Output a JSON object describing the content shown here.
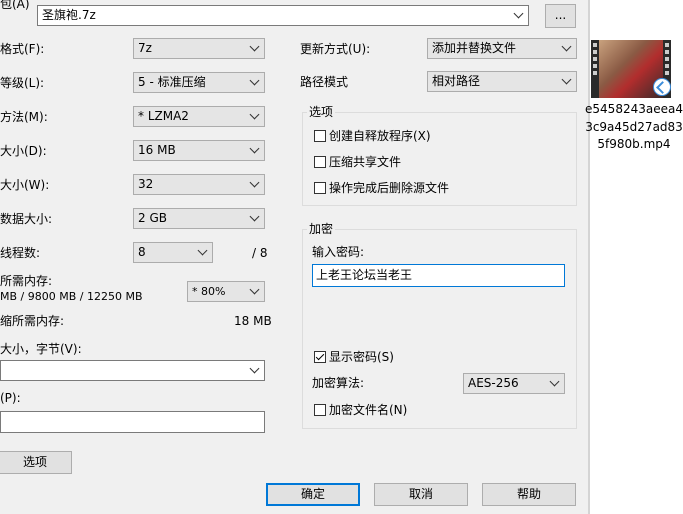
{
  "archive": {
    "label": "包(A)",
    "value": "圣旗袍.7z",
    "browse_label": "..."
  },
  "left": {
    "format": {
      "label": "格式(F):",
      "value": "7z"
    },
    "level": {
      "label": "等级(L):",
      "value": "5 - 标准压缩"
    },
    "method": {
      "label": "方法(M):",
      "value": "* LZMA2"
    },
    "dict": {
      "label": "大小(D):",
      "value": "16 MB"
    },
    "word": {
      "label": "大小(W):",
      "value": "32"
    },
    "solid": {
      "label": "数据大小:",
      "value": "2 GB"
    },
    "threads": {
      "label": "线程数:",
      "value": "8",
      "max": "/ 8"
    },
    "mem_compress": {
      "label": "所需内存:",
      "value": "MB / 9800 MB / 12250 MB",
      "percent": "* 80%"
    },
    "mem_decompress": {
      "label": "缩所需内存:",
      "value": "18 MB"
    },
    "split": {
      "label": "大小，字节(V):",
      "value": ""
    },
    "params": {
      "label": "(P):",
      "value": ""
    },
    "options_button": "选项"
  },
  "right": {
    "update": {
      "label": "更新方式(U):",
      "value": "添加并替换文件"
    },
    "path": {
      "label": "路径模式",
      "value": "相对路径"
    },
    "options": {
      "title": "选项",
      "sfx": {
        "label": "创建自释放程序(X)",
        "checked": false
      },
      "shared": {
        "label": "压缩共享文件",
        "checked": false
      },
      "delete": {
        "label": "操作完成后删除源文件",
        "checked": false
      }
    },
    "encryption": {
      "title": "加密",
      "password_label": "输入密码:",
      "password_value": "上老王论坛当老王",
      "show_password": {
        "label": "显示密码(S)",
        "checked": true
      },
      "method_label": "加密算法:",
      "method_value": "AES-256",
      "encrypt_names": {
        "label": "加密文件名(N)",
        "checked": false
      }
    }
  },
  "buttons": {
    "ok": "确定",
    "cancel": "取消",
    "help": "帮助"
  },
  "desktop_file": {
    "name_lines": [
      "e5458243aeea4",
      "3c9a45d27ad83",
      "5f980b.mp4"
    ],
    "icon": "video-file-icon"
  }
}
